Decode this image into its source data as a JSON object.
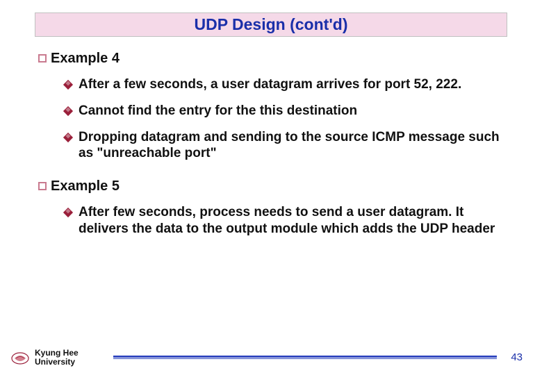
{
  "title": "UDP Design (cont'd)",
  "sections": [
    {
      "heading": "Example 4",
      "items": [
        "After a few seconds, a user datagram arrives for port 52, 222.",
        "Cannot find the entry for the this destination",
        "Dropping datagram and sending to the source ICMP message such as \"unreachable port\""
      ]
    },
    {
      "heading": "Example 5",
      "items": [
        "After few seconds, process needs to send a user datagram. It delivers the data to the output module which adds the UDP header"
      ]
    }
  ],
  "footer": {
    "university": "Kyung Hee\nUniversity",
    "page": "43"
  }
}
